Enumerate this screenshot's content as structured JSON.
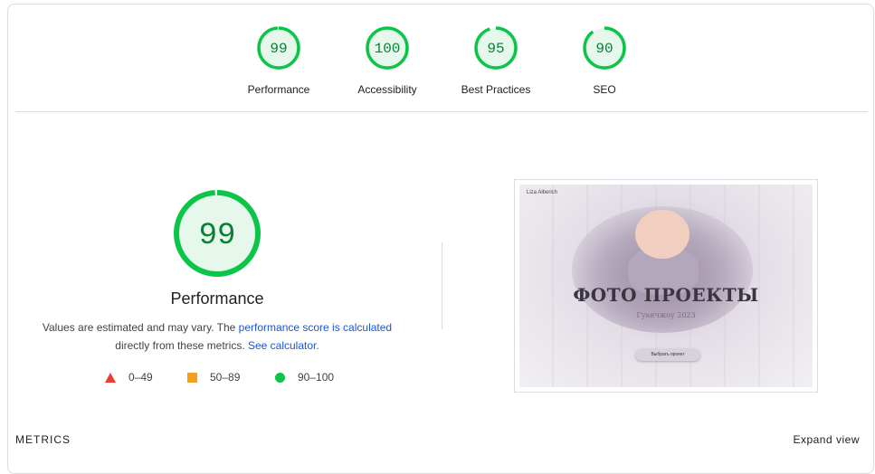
{
  "categories": [
    {
      "score": "99",
      "label": "Performance",
      "fraction": 0.99
    },
    {
      "score": "100",
      "label": "Accessibility",
      "fraction": 1.0
    },
    {
      "score": "95",
      "label": "Best Practices",
      "fraction": 0.95
    },
    {
      "score": "90",
      "label": "SEO",
      "fraction": 0.9
    }
  ],
  "main": {
    "score": "99",
    "fraction": 0.99,
    "title": "Performance",
    "desc_prefix": "Values are estimated and may vary. The ",
    "desc_link": "performance score is calculated",
    "desc_middle": "directly from these metrics. ",
    "desc_link2": "See calculator."
  },
  "legend": [
    {
      "range": "0–49",
      "shape": "triangle",
      "color": "#eb3c35"
    },
    {
      "range": "50–89",
      "shape": "square",
      "color": "#f4a01f"
    },
    {
      "range": "90–100",
      "shape": "circle",
      "color": "#0cc448"
    }
  ],
  "screenshot": {
    "logo": "Liza Alberich",
    "title": "ФОТО ПРОЕКТЫ",
    "subtitle": "Гуанчжоу 2023",
    "button": "Выбрать проект"
  },
  "metrics_label": "METRICS",
  "expand_label": "Expand view",
  "colors": {
    "pass": "#0cc448",
    "pass_text": "#0b7f35",
    "pass_bg": "#e6f8ec",
    "link": "#1a56db"
  }
}
